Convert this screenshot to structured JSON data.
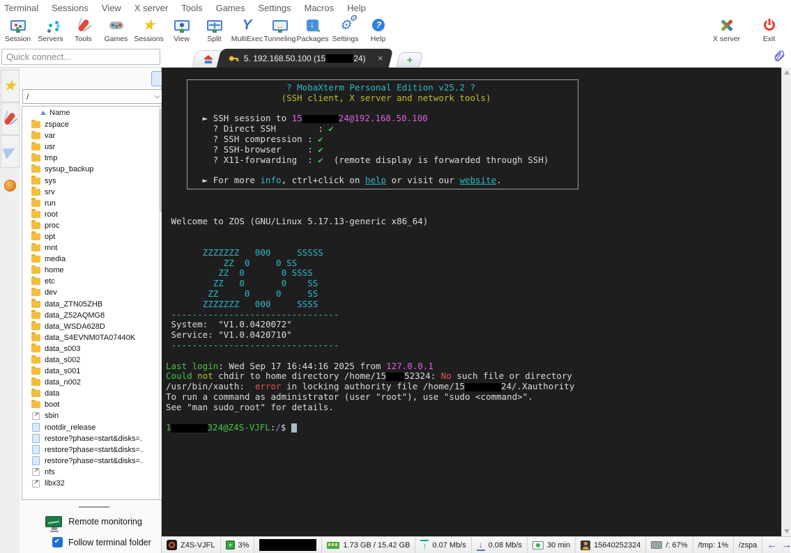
{
  "menubar": {
    "items": [
      "Terminal",
      "Sessions",
      "View",
      "X server",
      "Tools",
      "Games",
      "Settings",
      "Macros",
      "Help"
    ]
  },
  "toolbar": {
    "left": [
      {
        "icon": "session-icon",
        "label": "Session"
      },
      {
        "icon": "servers-icon",
        "label": "Servers"
      },
      {
        "icon": "tools-icon",
        "label": "Tools"
      },
      {
        "icon": "games-icon",
        "label": "Games"
      },
      {
        "icon": "sessions-star-icon",
        "label": "Sessions"
      },
      {
        "icon": "view-icon",
        "label": "View"
      },
      {
        "icon": "split-icon",
        "label": "Split"
      },
      {
        "icon": "multiexec-icon",
        "label": "MultiExec"
      },
      {
        "icon": "tunneling-icon",
        "label": "Tunneling"
      },
      {
        "icon": "packages-icon",
        "label": "Packages"
      },
      {
        "icon": "settings-icon",
        "label": "Settings"
      },
      {
        "icon": "help-icon",
        "label": "Help"
      }
    ],
    "right": [
      {
        "icon": "xserver-icon",
        "label": "X server"
      },
      {
        "icon": "exit-icon",
        "label": "Exit"
      }
    ]
  },
  "quick_connect": {
    "placeholder": "Quick connect..."
  },
  "tabs": {
    "active": {
      "prefix": "5. 192.168.50.100 (15",
      "suffix": "24)",
      "close": "×"
    }
  },
  "sidebar": {
    "strip": [
      "star-icon",
      "knife-icon",
      "paper-plane-icon",
      "globe-icon"
    ],
    "sftp_toolbar": [
      "parent-folder-icon",
      "download-icon",
      "upload-icon",
      "refresh-icon",
      "new-folder-icon",
      "new-file-icon",
      "delete-icon",
      "encoding-icon",
      "panel-icon"
    ],
    "path": {
      "value": "/"
    },
    "header": {
      "name": "Name"
    },
    "files": [
      {
        "label": "zspace",
        "type": "folder"
      },
      {
        "label": "var",
        "type": "folder"
      },
      {
        "label": "usr",
        "type": "folder"
      },
      {
        "label": "tmp",
        "type": "folder"
      },
      {
        "label": "sysup_backup",
        "type": "folder"
      },
      {
        "label": "sys",
        "type": "folder"
      },
      {
        "label": "srv",
        "type": "folder"
      },
      {
        "label": "run",
        "type": "folder"
      },
      {
        "label": "root",
        "type": "folder"
      },
      {
        "label": "proc",
        "type": "folder"
      },
      {
        "label": "opt",
        "type": "folder"
      },
      {
        "label": "mnt",
        "type": "folder"
      },
      {
        "label": "media",
        "type": "folder"
      },
      {
        "label": "home",
        "type": "folder"
      },
      {
        "label": "etc",
        "type": "folder"
      },
      {
        "label": "dev",
        "type": "folder"
      },
      {
        "label": "data_ZTN05ZHB",
        "type": "folder"
      },
      {
        "label": "data_Z52AQMG8",
        "type": "folder"
      },
      {
        "label": "data_WSDA628D",
        "type": "folder"
      },
      {
        "label": "data_S4EVNM0TA07440K",
        "type": "folder"
      },
      {
        "label": "data_s003",
        "type": "folder"
      },
      {
        "label": "data_s002",
        "type": "folder"
      },
      {
        "label": "data_s001",
        "type": "folder"
      },
      {
        "label": "data_n002",
        "type": "folder"
      },
      {
        "label": "data",
        "type": "folder"
      },
      {
        "label": "boot",
        "type": "folder"
      },
      {
        "label": "sbin",
        "type": "link"
      },
      {
        "label": "rootdir_release",
        "type": "file"
      },
      {
        "label": "restore?phase=start&disks=.",
        "type": "file"
      },
      {
        "label": "restore?phase=start&disks=.",
        "type": "file"
      },
      {
        "label": "restore?phase=start&disks=.",
        "type": "file"
      },
      {
        "label": "nfs",
        "type": "link"
      },
      {
        "label": "libx32",
        "type": "link"
      }
    ],
    "remote_monitoring": {
      "label": "Remote monitoring"
    },
    "follow": {
      "label": "Follow terminal folder",
      "checked": true
    }
  },
  "terminal": {
    "lines": [
      [
        {
          "t": "                       ? MobaXterm Personal Edition v25.2 ?",
          "c": "cyan"
        }
      ],
      [
        {
          "t": "                      (SSH client, X server and network tools)",
          "c": "yellow"
        }
      ],
      [],
      [
        {
          "t": "       ► SSH session to ",
          "c": "fg"
        },
        {
          "t": "15",
          "c": "magenta"
        },
        {
          "r": 52
        },
        {
          "t": "24@192.168.50.100",
          "c": "magenta"
        }
      ],
      [
        {
          "t": "         ? Direct SSH        : ",
          "c": "fg"
        },
        {
          "t": "✔",
          "c": "green"
        }
      ],
      [
        {
          "t": "         ? SSH compression : ",
          "c": "fg"
        },
        {
          "t": "✔",
          "c": "green"
        }
      ],
      [
        {
          "t": "         ? SSH-browser     : ",
          "c": "fg"
        },
        {
          "t": "✔",
          "c": "green"
        }
      ],
      [
        {
          "t": "         ? X11-forwarding  : ",
          "c": "fg"
        },
        {
          "t": "✔",
          "c": "green"
        },
        {
          "t": "  (remote display is forwarded through SSH)",
          "c": "fg"
        }
      ],
      [],
      [
        {
          "t": "       ► For more ",
          "c": "fg"
        },
        {
          "t": "info",
          "c": "cyan"
        },
        {
          "t": ", ctrl+click on ",
          "c": "fg"
        },
        {
          "t": "help",
          "c": "link"
        },
        {
          "t": " or visit our ",
          "c": "fg"
        },
        {
          "t": "website",
          "c": "link"
        },
        {
          "t": ".",
          "c": "fg"
        }
      ],
      [],
      [],
      [],
      [
        {
          "t": " Welcome to ZOS (GNU/Linux 5.17.13-generic x86_64)",
          "c": "fg"
        }
      ],
      [],
      [],
      [
        {
          "t": "       ZZZZZZZ   000     SSSSS",
          "c": "cyan"
        }
      ],
      [
        {
          "t": "           ZZ  0     0 SS",
          "c": "cyan"
        }
      ],
      [
        {
          "t": "          ZZ  0       0 SSSS",
          "c": "cyan"
        }
      ],
      [
        {
          "t": "         ZZ   0       0    SS",
          "c": "cyan"
        }
      ],
      [
        {
          "t": "        ZZ     0     0     SS",
          "c": "cyan"
        }
      ],
      [
        {
          "t": "       ZZZZZZZ   000     SSSS",
          "c": "cyan"
        }
      ],
      [
        {
          "t": " --------------------------------",
          "c": "cyan"
        }
      ],
      [
        {
          "t": " System:  \"V1.0.0420072\"",
          "c": "fg"
        }
      ],
      [
        {
          "t": " Service: \"V1.0.0420710\"",
          "c": "fg"
        }
      ],
      [
        {
          "t": " --------------------------------",
          "c": "cyan"
        }
      ],
      [],
      [
        {
          "t": "Last login",
          "c": "green"
        },
        {
          "t": ": Wed Sep 17 16:44:16 2025 from ",
          "c": "fg"
        },
        {
          "t": "127.0.0.1",
          "c": "magenta"
        }
      ],
      [
        {
          "t": "Could",
          "c": "green"
        },
        {
          "t": " ",
          "c": "fg"
        },
        {
          "t": "not",
          "c": "yellow"
        },
        {
          "t": " chdir to home directory /home/15",
          "c": "fg"
        },
        {
          "r": 26
        },
        {
          "t": "52324: ",
          "c": "fg"
        },
        {
          "t": "No",
          "c": "red"
        },
        {
          "t": " such file or directory",
          "c": "fg"
        }
      ],
      [
        {
          "t": "/usr/bin/xauth:  ",
          "c": "fg"
        },
        {
          "t": "error",
          "c": "red"
        },
        {
          "t": " in locking authority file /home/15",
          "c": "fg"
        },
        {
          "r": 52
        },
        {
          "t": "24/.Xauthority",
          "c": "fg"
        }
      ],
      [
        {
          "t": "To run a command as administrator (user \"root\"), use \"sudo <command>\".",
          "c": "fg"
        }
      ],
      [
        {
          "t": "See \"man sudo_root\" for details.",
          "c": "fg"
        }
      ],
      [],
      [
        {
          "t": "1",
          "c": "green"
        },
        {
          "r": 52
        },
        {
          "t": "324@Z4S-VJFL",
          "c": "green"
        },
        {
          "t": ":",
          "c": "fg"
        },
        {
          "t": "/",
          "c": "blue"
        },
        {
          "t": "$ ",
          "c": "fg"
        },
        {
          "cur": true
        }
      ]
    ]
  },
  "status": {
    "segments": [
      {
        "icon": "host-icon",
        "label": "Z4S-VJFL"
      },
      {
        "icon": "cpu-icon",
        "label": "3%"
      },
      {
        "icon": "redacted",
        "label": ""
      },
      {
        "icon": "ram-icon",
        "label": "1.73 GB / 15.42 GB"
      },
      {
        "icon": "upload-arrow-icon",
        "label": "0.07 Mb/s"
      },
      {
        "icon": "download-arrow-icon",
        "label": "0.08 Mb/s"
      },
      {
        "icon": "uptime-icon",
        "label": "30 min"
      },
      {
        "icon": "user-icon",
        "label": "15640252324"
      },
      {
        "icon": "disk-icon",
        "label": "/: 67%"
      },
      {
        "icon": null,
        "label": "/tmp: 1%"
      },
      {
        "icon": null,
        "label": "/zspa"
      }
    ],
    "nav": {
      "left": "←",
      "right": "→"
    }
  }
}
